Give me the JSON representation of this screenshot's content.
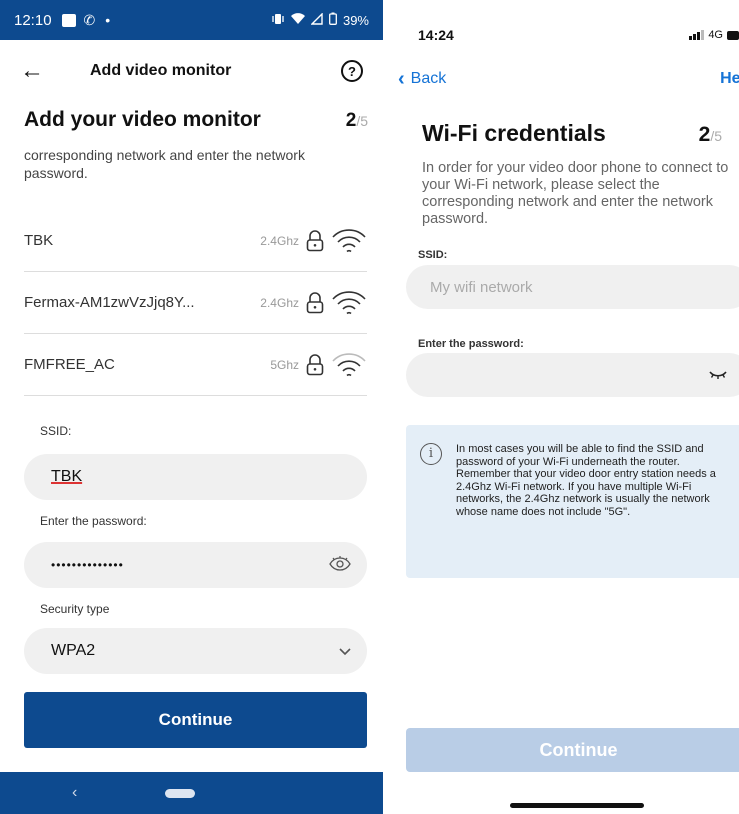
{
  "android": {
    "status": {
      "time": "12:10",
      "battery": "39%"
    },
    "appbar": {
      "title": "Add video monitor"
    },
    "heading": {
      "title": "Add your video monitor",
      "step": "2",
      "total": "/5"
    },
    "description": "corresponding network and enter the network password.",
    "networks": [
      {
        "name": "TBK",
        "band": "2.4Ghz"
      },
      {
        "name": "Fermax-AM1zwVzJjq8Y...",
        "band": "2.4Ghz"
      },
      {
        "name": "FMFREE_AC",
        "band": "5Ghz"
      }
    ],
    "form": {
      "ssid_label": "SSID:",
      "ssid_value": "TBK",
      "password_label": "Enter the password:",
      "password_value": "••••••••••••••",
      "security_label": "Security type",
      "security_value": "WPA2"
    },
    "continue_label": "Continue",
    "nav": {
      "back_glyph": "‹"
    },
    "colors": {
      "brand": "#0d4a8f"
    }
  },
  "ios": {
    "status": {
      "time": "14:24",
      "network": "4G"
    },
    "nav": {
      "back_label": "Back",
      "help_label": "Hel"
    },
    "heading": {
      "title": "Wi-Fi credentials",
      "step": "2",
      "total": "/5"
    },
    "description": "In order for your video door phone to connect to your Wi-Fi network, please select the corresponding network and enter the network password.",
    "form": {
      "ssid_label": "SSID:",
      "ssid_placeholder": "My wifi network",
      "password_label": "Enter the password:"
    },
    "info": {
      "line1": "In most cases you will be able to find the SSID and password of your Wi-Fi underneath the router.",
      "line2": "Remember that your video door entry station needs a 2.4Ghz Wi-Fi network. If you have multiple Wi-Fi networks, the 2.4Ghz network is usually the network whose name does not include \"5G\"."
    },
    "continue_label": "Continue",
    "colors": {
      "link": "#1573d6",
      "info_bg": "#e4eef7",
      "button_disabled": "#b9cde6"
    }
  }
}
